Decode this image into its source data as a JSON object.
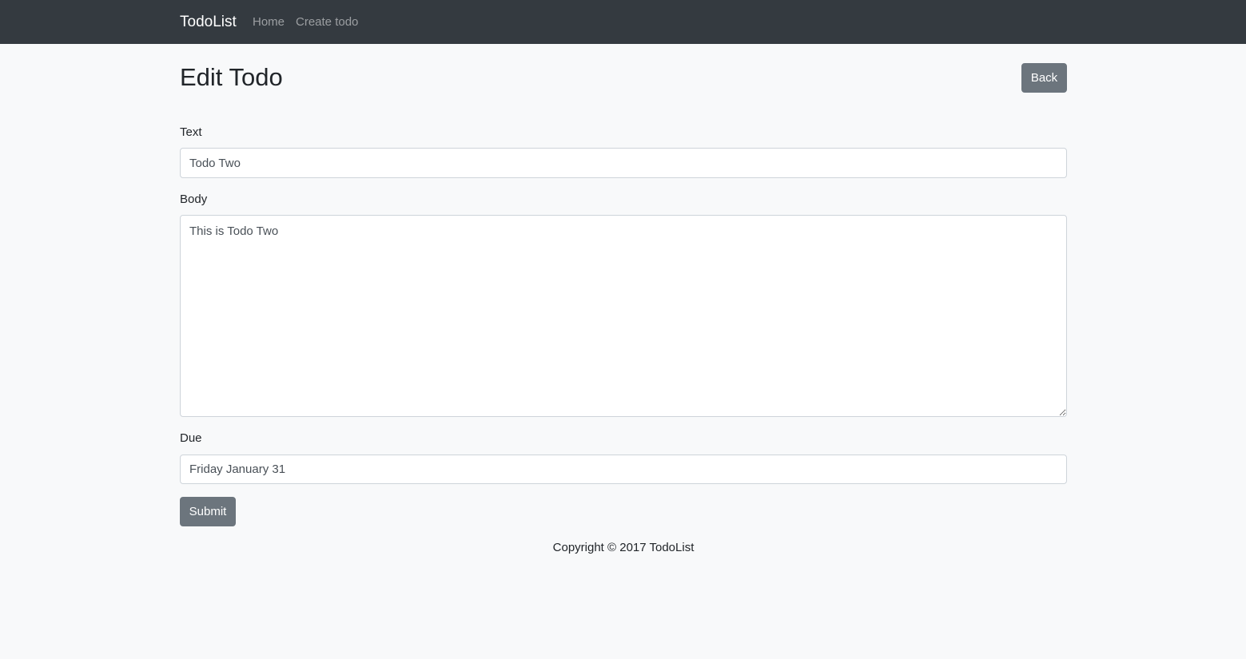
{
  "navbar": {
    "brand": "TodoList",
    "links": [
      "Home",
      "Create todo"
    ]
  },
  "page": {
    "title": "Edit Todo",
    "back_label": "Back"
  },
  "form": {
    "text_label": "Text",
    "text_value": "Todo Two",
    "body_label": "Body",
    "body_value": "This is Todo Two",
    "due_label": "Due",
    "due_value": "Friday January 31",
    "submit_label": "Submit"
  },
  "footer": {
    "copyright": "Copyright © 2017 TodoList"
  },
  "colors": {
    "navbar_bg": "#343a40",
    "page_bg": "#f8f9fa",
    "button_secondary": "#6c757d"
  }
}
